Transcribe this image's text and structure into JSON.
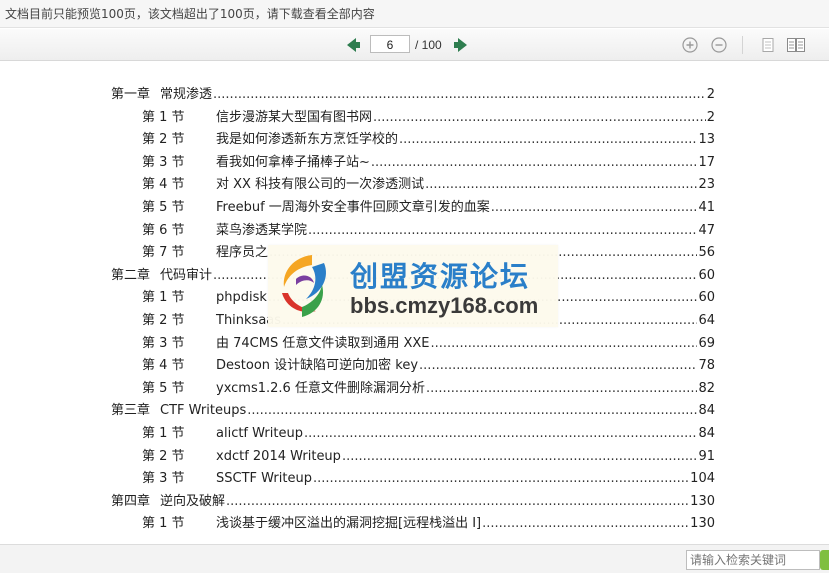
{
  "notice": {
    "text": "文档目前只能预览100页，该文档超出了100页，请下载查看全部内容"
  },
  "toolbar": {
    "current_page": "6",
    "total_pages": "/ 100",
    "icons": {
      "prev": "arrow-left-icon",
      "next": "arrow-right-icon",
      "zoom_in": "zoom-in-icon",
      "zoom_out": "zoom-out-icon",
      "single": "single-page-view-icon",
      "double": "double-page-view-icon"
    }
  },
  "toc": [
    {
      "type": "chapter",
      "prefix": "第一章",
      "title": "常规渗透",
      "page": "2"
    },
    {
      "type": "section",
      "prefix": "第 1 节",
      "title": "信步漫游某大型国有图书网",
      "page": "2"
    },
    {
      "type": "section",
      "prefix": "第 2 节",
      "title": "我是如何渗透新东方烹饪学校的",
      "page": "13"
    },
    {
      "type": "section",
      "prefix": "第 3 节",
      "title": "看我如何拿棒子捅棒子站~",
      "page": "17"
    },
    {
      "type": "section",
      "prefix": "第 4 节",
      "title": "对 XX 科技有限公司的一次渗透测试",
      "page": "23"
    },
    {
      "type": "section",
      "prefix": "第 5 节",
      "title": "Freebuf 一周海外安全事件回顾文章引发的血案",
      "page": "41"
    },
    {
      "type": "section",
      "prefix": "第 6 节",
      "title": "菜鸟渗透某学院",
      "page": "47"
    },
    {
      "type": "section",
      "prefix": "第 7 节",
      "title": "程序员之",
      "page": "56"
    },
    {
      "type": "chapter",
      "prefix": "第二章",
      "title": "代码审计",
      "page": "60"
    },
    {
      "type": "section",
      "prefix": "第 1 节",
      "title": "phpdisk",
      "page": "60"
    },
    {
      "type": "section",
      "prefix": "第 2 节",
      "title": "Thinksaas",
      "page": "64"
    },
    {
      "type": "section",
      "prefix": "第 3 节",
      "title": "由 74CMS 任意文件读取到通用 XXE",
      "page": "69"
    },
    {
      "type": "section",
      "prefix": "第 4 节",
      "title": "Destoon 设计缺陷可逆向加密 key",
      "page": "78"
    },
    {
      "type": "section",
      "prefix": "第 5 节",
      "title": "yxcms1.2.6 任意文件删除漏洞分析",
      "page": "82"
    },
    {
      "type": "chapter",
      "prefix": "第三章",
      "title": "CTF Writeups",
      "page": "84"
    },
    {
      "type": "section",
      "prefix": "第 1 节",
      "title": "alictf Writeup",
      "page": "84"
    },
    {
      "type": "section",
      "prefix": "第 2 节",
      "title": "xdctf 2014 Writeup",
      "page": "91"
    },
    {
      "type": "section",
      "prefix": "第 3 节",
      "title": "SSCTF Writeup",
      "page": "104"
    },
    {
      "type": "chapter",
      "prefix": "第四章",
      "title": "逆向及破解",
      "page": "130"
    },
    {
      "type": "section",
      "prefix": "第 1 节",
      "title": "浅谈基于缓冲区溢出的漏洞挖掘[远程栈溢出 I]",
      "page": "130"
    }
  ],
  "watermark": {
    "title": "创盟资源论坛",
    "url": "bbs.cmzy168.com",
    "logo_icon": "swirl-logo-icon"
  },
  "statusbar": {
    "search_placeholder": "请输入检索关键词"
  },
  "colors": {
    "nav_arrow": "#2e7d4f",
    "watermark_title": "#2a7fc9",
    "search_button": "#7fbf3f"
  }
}
